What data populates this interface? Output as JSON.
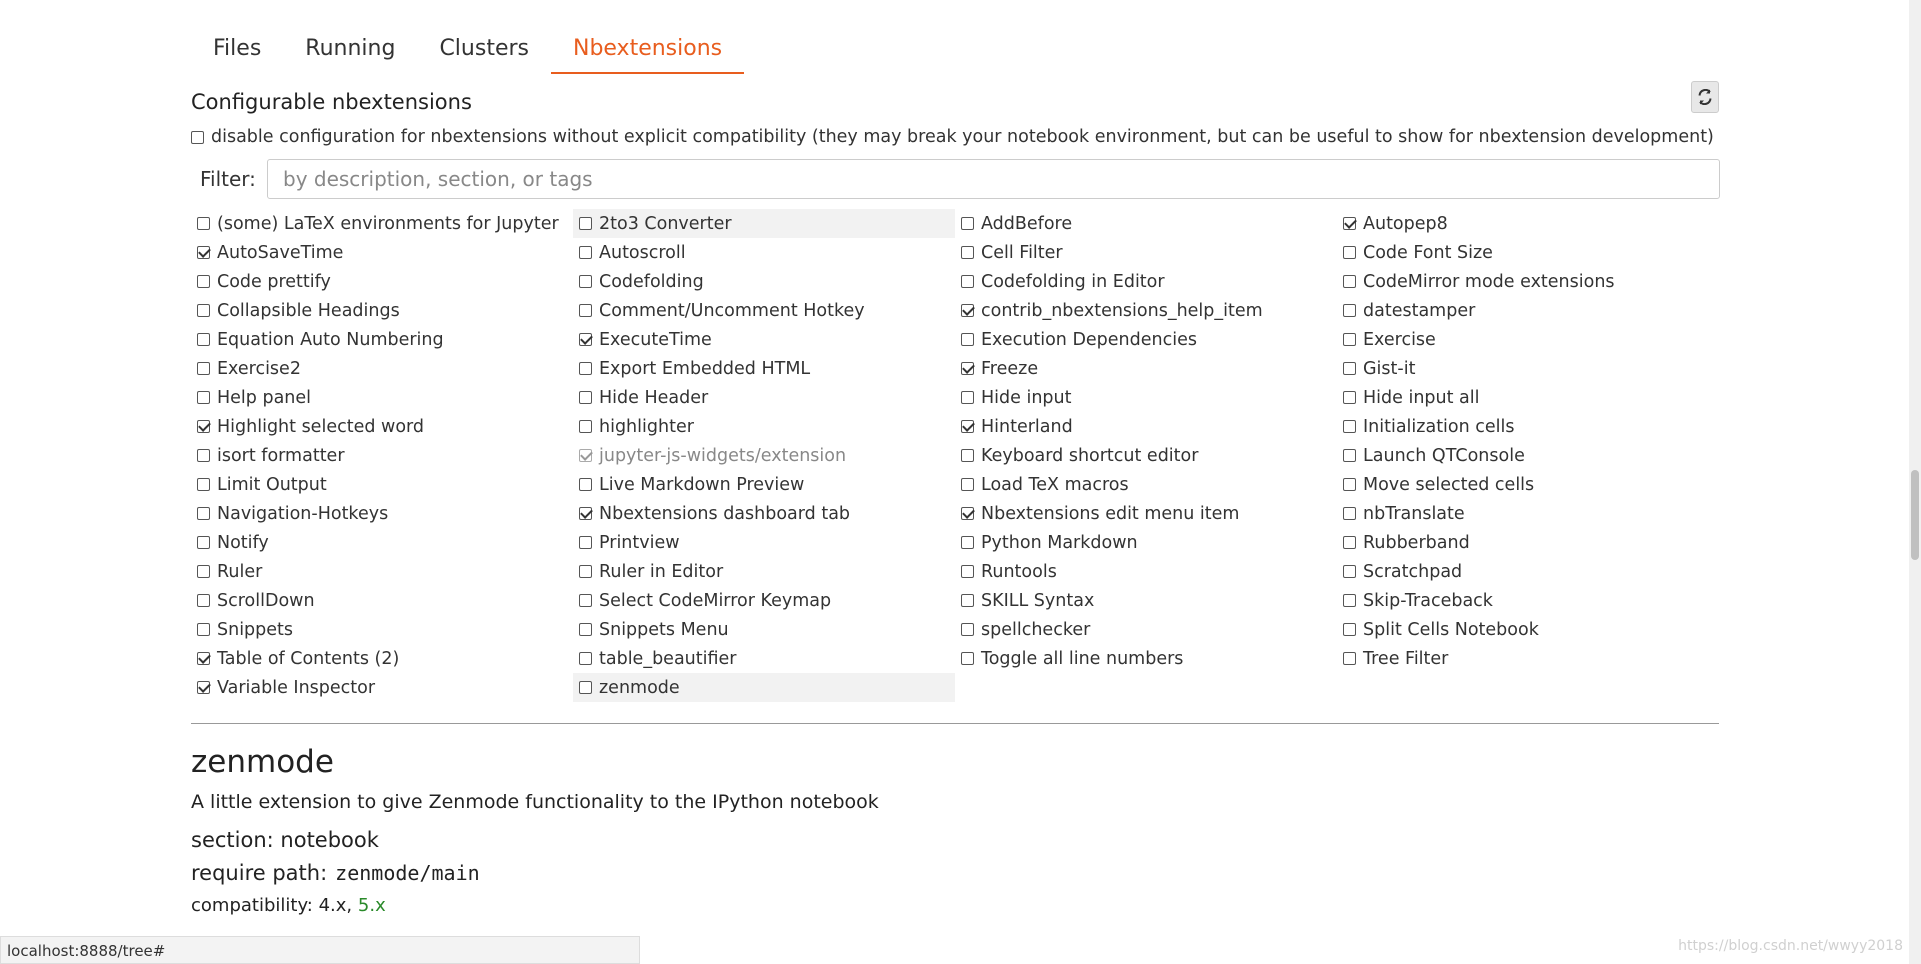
{
  "tabs": [
    {
      "label": "Files"
    },
    {
      "label": "Running"
    },
    {
      "label": "Clusters"
    },
    {
      "label": "Nbextensions",
      "active": true
    }
  ],
  "heading": "Configurable nbextensions",
  "disable_config_label": "disable configuration for nbextensions without explicit compatibility (they may break your notebook environment, but can be useful to show for nbextension development)",
  "filter": {
    "label": "Filter:",
    "placeholder": "by description, section, or tags",
    "value": ""
  },
  "extensions": [
    {
      "name": "(some) LaTeX environments for Jupyter",
      "checked": false
    },
    {
      "name": "2to3 Converter",
      "checked": false,
      "highlight": true
    },
    {
      "name": "AddBefore",
      "checked": false
    },
    {
      "name": "Autopep8",
      "checked": true
    },
    {
      "name": "AutoSaveTime",
      "checked": true
    },
    {
      "name": "Autoscroll",
      "checked": false
    },
    {
      "name": "Cell Filter",
      "checked": false
    },
    {
      "name": "Code Font Size",
      "checked": false
    },
    {
      "name": "Code prettify",
      "checked": false
    },
    {
      "name": "Codefolding",
      "checked": false
    },
    {
      "name": "Codefolding in Editor",
      "checked": false
    },
    {
      "name": "CodeMirror mode extensions",
      "checked": false
    },
    {
      "name": "Collapsible Headings",
      "checked": false
    },
    {
      "name": "Comment/Uncomment Hotkey",
      "checked": false
    },
    {
      "name": "contrib_nbextensions_help_item",
      "checked": true
    },
    {
      "name": "datestamper",
      "checked": false
    },
    {
      "name": "Equation Auto Numbering",
      "checked": false
    },
    {
      "name": "ExecuteTime",
      "checked": true
    },
    {
      "name": "Execution Dependencies",
      "checked": false
    },
    {
      "name": "Exercise",
      "checked": false
    },
    {
      "name": "Exercise2",
      "checked": false
    },
    {
      "name": "Export Embedded HTML",
      "checked": false
    },
    {
      "name": "Freeze",
      "checked": true
    },
    {
      "name": "Gist-it",
      "checked": false
    },
    {
      "name": "Help panel",
      "checked": false
    },
    {
      "name": "Hide Header",
      "checked": false
    },
    {
      "name": "Hide input",
      "checked": false
    },
    {
      "name": "Hide input all",
      "checked": false
    },
    {
      "name": "Highlight selected word",
      "checked": true
    },
    {
      "name": "highlighter",
      "checked": false
    },
    {
      "name": "Hinterland",
      "checked": true
    },
    {
      "name": "Initialization cells",
      "checked": false
    },
    {
      "name": "isort formatter",
      "checked": false
    },
    {
      "name": "jupyter-js-widgets/extension",
      "checked": true,
      "disabled": true
    },
    {
      "name": "Keyboard shortcut editor",
      "checked": false
    },
    {
      "name": "Launch QTConsole",
      "checked": false
    },
    {
      "name": "Limit Output",
      "checked": false
    },
    {
      "name": "Live Markdown Preview",
      "checked": false
    },
    {
      "name": "Load TeX macros",
      "checked": false
    },
    {
      "name": "Move selected cells",
      "checked": false
    },
    {
      "name": "Navigation-Hotkeys",
      "checked": false
    },
    {
      "name": "Nbextensions dashboard tab",
      "checked": true
    },
    {
      "name": "Nbextensions edit menu item",
      "checked": true
    },
    {
      "name": "nbTranslate",
      "checked": false
    },
    {
      "name": "Notify",
      "checked": false
    },
    {
      "name": "Printview",
      "checked": false
    },
    {
      "name": "Python Markdown",
      "checked": false
    },
    {
      "name": "Rubberband",
      "checked": false
    },
    {
      "name": "Ruler",
      "checked": false
    },
    {
      "name": "Ruler in Editor",
      "checked": false
    },
    {
      "name": "Runtools",
      "checked": false
    },
    {
      "name": "Scratchpad",
      "checked": false
    },
    {
      "name": "ScrollDown",
      "checked": false
    },
    {
      "name": "Select CodeMirror Keymap",
      "checked": false
    },
    {
      "name": "SKILL Syntax",
      "checked": false
    },
    {
      "name": "Skip-Traceback",
      "checked": false
    },
    {
      "name": "Snippets",
      "checked": false
    },
    {
      "name": "Snippets Menu",
      "checked": false
    },
    {
      "name": "spellchecker",
      "checked": false
    },
    {
      "name": "Split Cells Notebook",
      "checked": false
    },
    {
      "name": "Table of Contents (2)",
      "checked": true
    },
    {
      "name": "table_beautifier",
      "checked": false
    },
    {
      "name": "Toggle all line numbers",
      "checked": false
    },
    {
      "name": "Tree Filter",
      "checked": false
    },
    {
      "name": "Variable Inspector",
      "checked": true
    },
    {
      "name": "zenmode",
      "checked": false,
      "highlight": true
    }
  ],
  "detail": {
    "title": "zenmode",
    "description": "A little extension to give Zenmode functionality to the IPython notebook",
    "section_label": "section:",
    "section_value": "notebook",
    "require_label": "require path:",
    "require_value": "zenmode/main",
    "compat_label": "compatibility:",
    "compat_plain": "4.x,",
    "compat_ok": "5.x"
  },
  "status_url": "localhost:8888/tree#",
  "watermark": "https://blog.csdn.net/wwyy2018",
  "icons": {
    "refresh": "refresh-icon"
  }
}
